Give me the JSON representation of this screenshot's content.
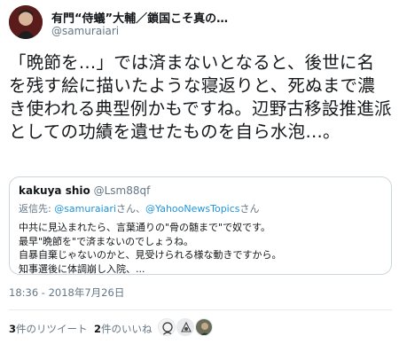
{
  "author": {
    "display_name": "有門“侍蟻”大輔／鎖国こそ真の…",
    "handle": "@samuraiari"
  },
  "tweet_text": "「晩節を…」では済まないとなると、後世に名を残す絵に描いたような寝返りと、死ぬまで濃き使われる典型例かもですね。辺野古移設推進派としての功績を遺せたものを自ら水泡…。",
  "quoted_tweet": {
    "display_name": "kakuya shio",
    "handle": "@Lsm88qf",
    "reply_prefix": "返信先: ",
    "reply_mention_1": "@samuraiari",
    "reply_sep": "さん、",
    "reply_mention_2": "@YahooNewsTopics",
    "reply_suffix": "さん",
    "lines": [
      "中共に見込まれたら、言葉通りの\"骨の髄まで\"で奴です。",
      "最早\"晩節を\"で済まないのでしょうね。",
      "自暴自棄じゃないのかと、見受けられる様な動きですから。",
      "知事選後に体調崩し入院、..."
    ]
  },
  "timestamp": "18:36 - 2018年7月26日",
  "stats": {
    "retweets_count": "3",
    "retweets_label": "件のリツイート",
    "likes_count": "2",
    "likes_label": "件のいいね"
  },
  "colors": {
    "text": "#14171a",
    "secondary": "#657786",
    "link": "#1b95e0",
    "border": "#ccd6dd"
  },
  "icons": [
    "avatar",
    "liker-avatar-1",
    "liker-avatar-2",
    "liker-avatar-3"
  ]
}
